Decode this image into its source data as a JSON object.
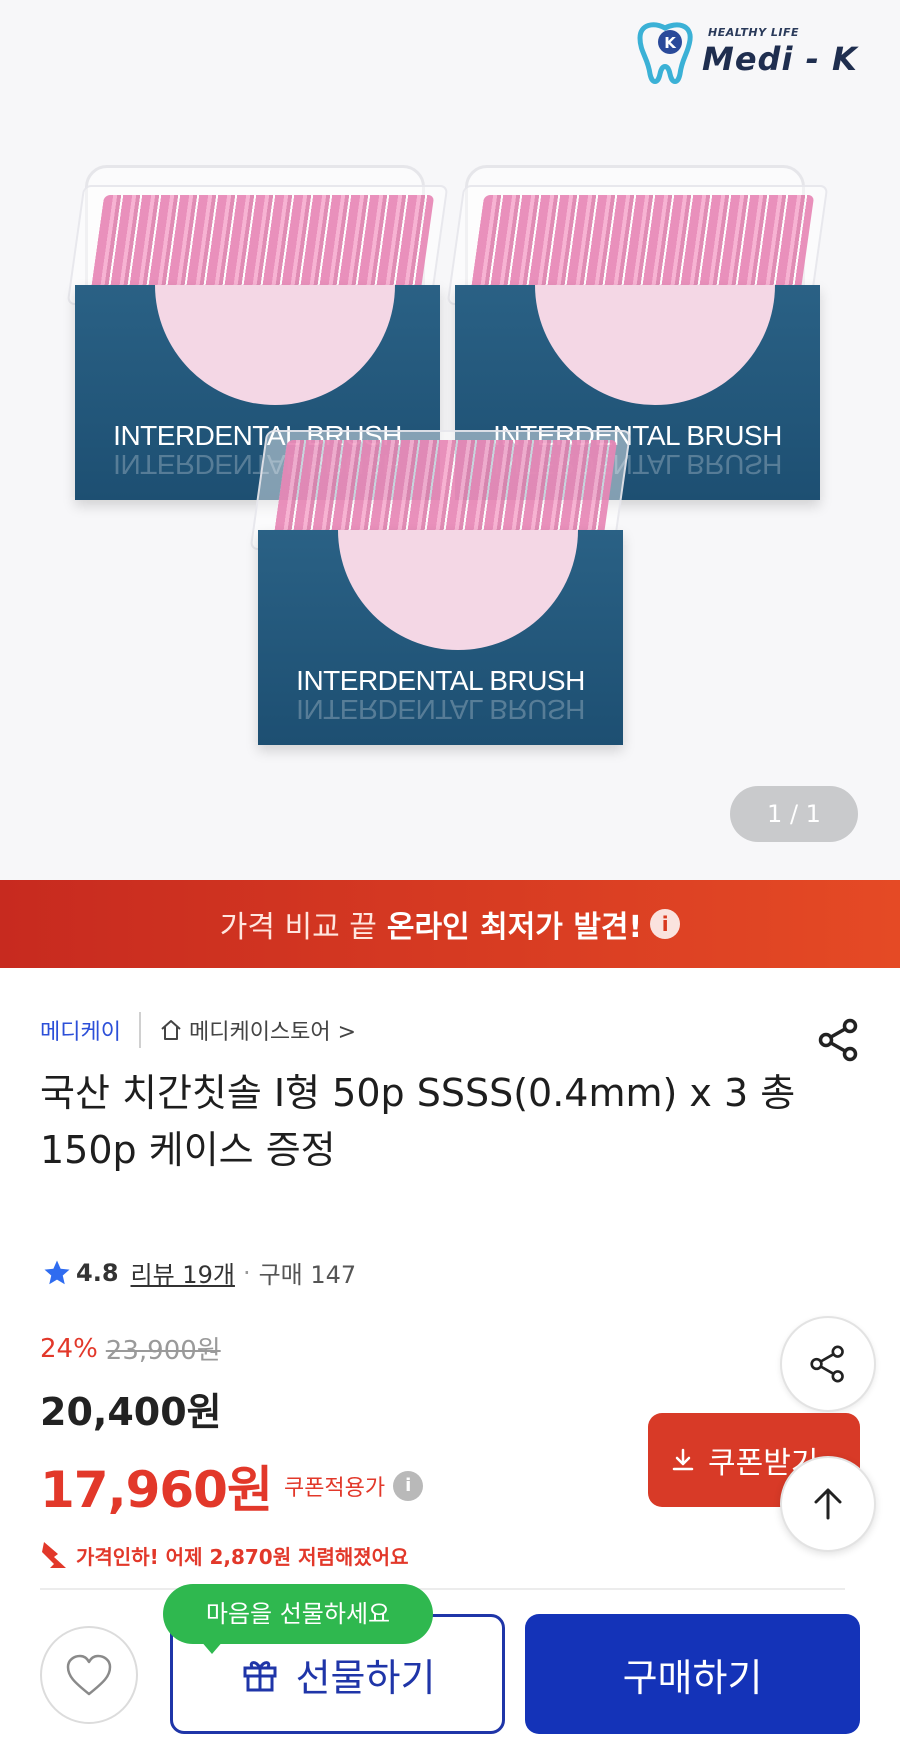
{
  "logo": {
    "tagline": "HEALTHY LIFE",
    "name": "Medi - K",
    "badge": "K"
  },
  "hero": {
    "packs": [
      {
        "label": "INTERDENTAL BRUSH"
      },
      {
        "label": "INTERDENTAL BRUSH"
      },
      {
        "label": "INTERDENTAL BRUSH"
      }
    ],
    "counter": "1 / 1"
  },
  "banner": {
    "light_text": "가격 비교 끝",
    "bold_text": "온라인 최저가 발견!",
    "info_icon": "i"
  },
  "seller": {
    "brand": "메디케이",
    "store": "메디케이스토어 >"
  },
  "product": {
    "title": "국산 치간칫솔 I형 50p SSSS(0.4mm) x 3 총 150p 케이스 증정",
    "rating": "4.8",
    "review": "리뷰 19개",
    "dot": "·",
    "purchases": "구매 147"
  },
  "price": {
    "discount": "24%",
    "original": "23,900원",
    "sale": "20,400원",
    "coupon_price": "17,960원",
    "coupon_label": "쿠폰적용가",
    "coupon_info": "i",
    "drop_notice": "가격인하! 어제 2,870원 저렴해졌어요"
  },
  "buttons": {
    "coupon": "쿠폰받기",
    "gift_bubble": "마음을 선물하세요",
    "gift": "선물하기",
    "buy": "구매하기"
  },
  "colors": {
    "accent_blue": "#1433b8",
    "price_red": "#e2382a",
    "banner_red": "#d83a27",
    "bubble_green": "#2fb84f"
  },
  "icons": [
    "share-icon",
    "star-icon",
    "home-icon",
    "heart-icon",
    "gift-icon",
    "download-icon",
    "arrow-up-icon",
    "price-down-arrow-icon",
    "info-icon"
  ]
}
